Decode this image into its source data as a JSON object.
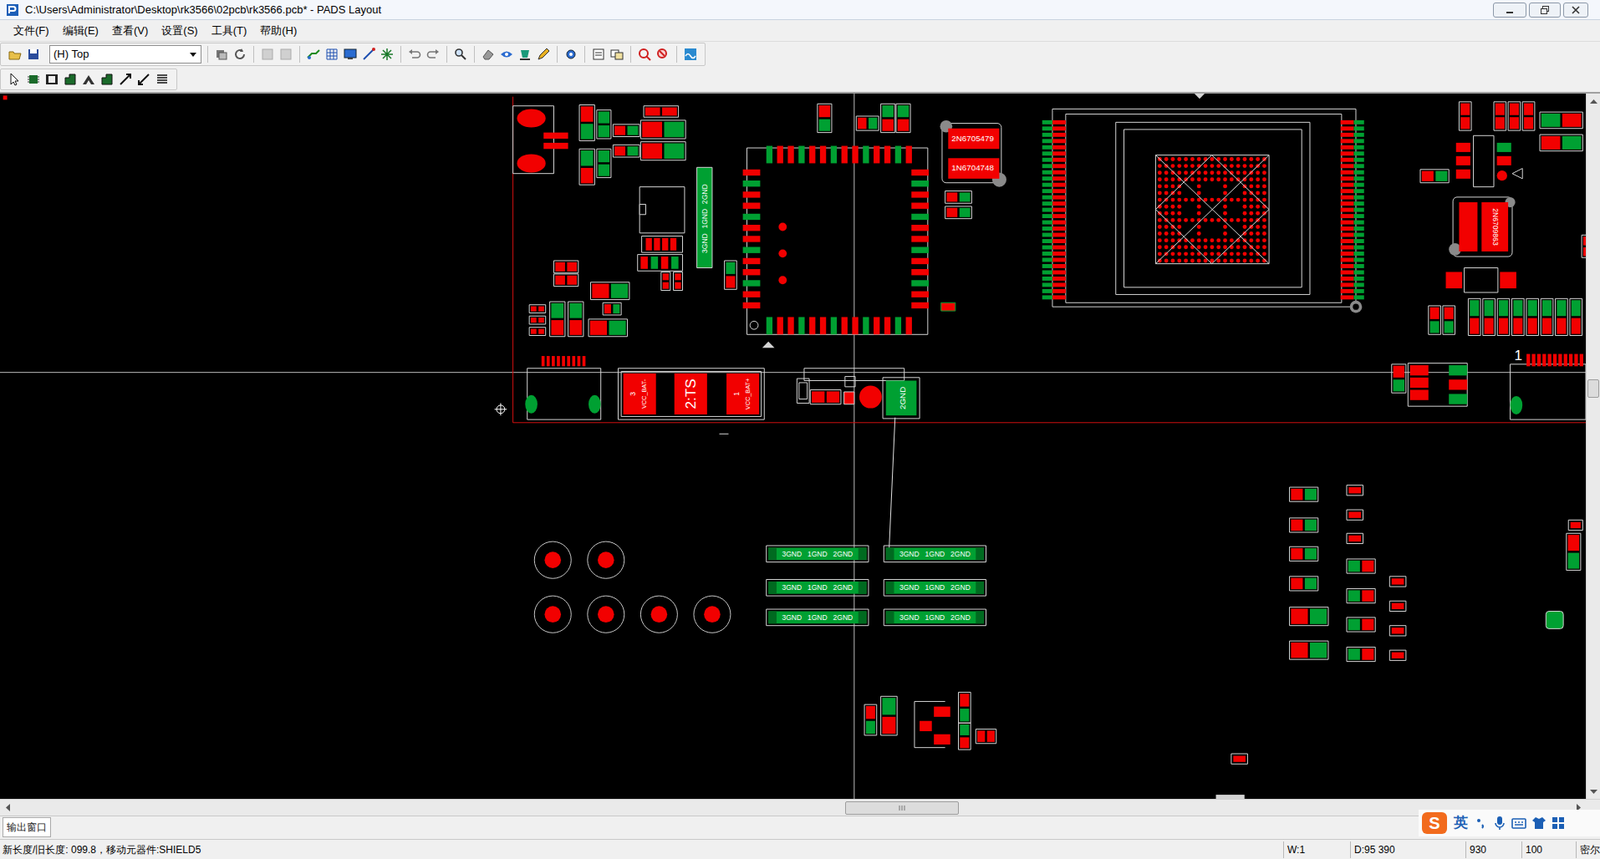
{
  "window": {
    "title": "C:\\Users\\Administrator\\Desktop\\rk3566\\02pcb\\rk3566.pcb* - PADS Layout"
  },
  "menu": [
    "文件(F)",
    "编辑(E)",
    "查看(V)",
    "设置(S)",
    "工具(T)",
    "帮助(H)"
  ],
  "toolbar": {
    "layer": "(H) Top"
  },
  "pcb": {
    "gnd_strip": [
      "2GND",
      "1GND",
      "3GND"
    ],
    "diode": [
      "2N6705479",
      "1N6704748"
    ],
    "battery": {
      "pins": [
        "3",
        "2:TS",
        "1"
      ],
      "nets": [
        "VCC_BAT-",
        "VCC_BAT+"
      ]
    },
    "shield_pad": "2GND",
    "right_part": "2N6709863",
    "connector_pin": "1",
    "gnd_groups": [
      [
        "3GND",
        "1GND",
        "2GND"
      ],
      [
        "3GND",
        "1GND",
        "2GND"
      ],
      [
        "3GND",
        "1GND",
        "2GND"
      ],
      [
        "3GND",
        "1GND",
        "2GND"
      ],
      [
        "3GND",
        "1GND",
        "2GND"
      ],
      [
        "3GND",
        "1GND",
        "2GND"
      ]
    ]
  },
  "output_tab": {
    "label": "输出窗口",
    "selected": true
  },
  "status_bar": {
    "message": "新长度/旧长度: 099.8，移动元器件:SHIELD5",
    "fields": [
      "W:1",
      "D:95 390",
      "930",
      "100",
      "密尔"
    ]
  },
  "ime": {
    "logo": "S",
    "mode": "英"
  }
}
